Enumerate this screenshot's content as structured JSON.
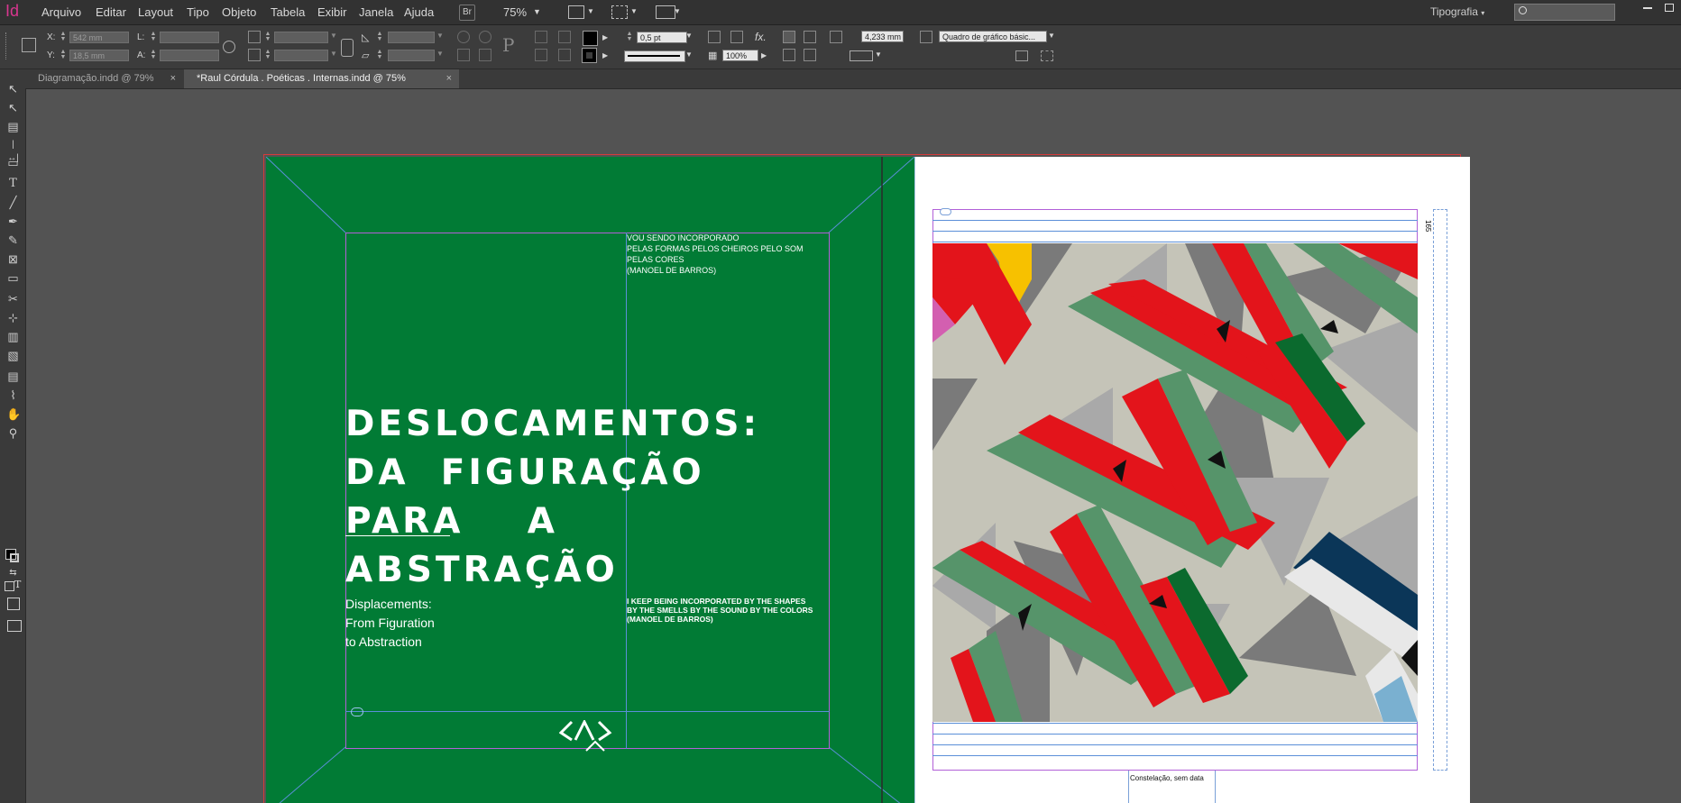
{
  "app": {
    "logo": "Id"
  },
  "menu": [
    "Arquivo",
    "Editar",
    "Layout",
    "Tipo",
    "Objeto",
    "Tabela",
    "Exibir",
    "Janela",
    "Ajuda"
  ],
  "menubar": {
    "bridge_label": "Br",
    "zoom": "75%",
    "workspace": "Tipografia",
    "workspace_caret": "▾"
  },
  "control": {
    "x_label": "X:",
    "x_value": "542 mm",
    "y_label": "Y:",
    "y_value": "18,5 mm",
    "w_label": "L:",
    "h_label": "A:",
    "stroke_weight": "0,5 pt",
    "opacity": "100%",
    "fx_label": "fx.",
    "offset": "4,233 mm",
    "frame_style": "Quadro de gráfico básic..."
  },
  "tabs": [
    {
      "label": "Diagramação.indd @ 79%",
      "close": "×",
      "active": false
    },
    {
      "label": "*Raul Córdula . Poéticas . Internas.indd @ 75%",
      "close": "×",
      "active": true
    }
  ],
  "page_left": {
    "title_lines": [
      "DESLOCAMENTOS:",
      "DA  FIGURAÇÃO",
      "PARA    A",
      "ABSTRAÇÃO"
    ],
    "subtitle_en": [
      "Displacements:",
      "From Figuration",
      "to Abstraction"
    ],
    "quote_pt": [
      "VOU SENDO INCORPORADO",
      "PELAS FORMAS PELOS CHEIROS PELO SOM",
      "PELAS CORES",
      "(MANOEL DE BARROS)"
    ],
    "quote_en": [
      "I KEEP BEING INCORPORATED BY THE SHAPES",
      "BY THE SMELLS BY THE SOUND BY THE COLORS",
      "(MANOEL DE BARROS)"
    ]
  },
  "page_right": {
    "caption": "Constelação, sem data",
    "page_number": "165"
  },
  "colors": {
    "page_green": "#017b35",
    "art_bg": "#c5c4b8",
    "art_red": "#e3141b",
    "art_green": "#56946a",
    "art_dark_green": "#0b6a2e",
    "art_gray": "#7a7a7a",
    "art_light_gray": "#a9a9a9",
    "art_yellow": "#f7c100",
    "art_navy": "#0b3658",
    "art_pink": "#d35fb0",
    "art_light_blue": "#7ab0d0"
  }
}
